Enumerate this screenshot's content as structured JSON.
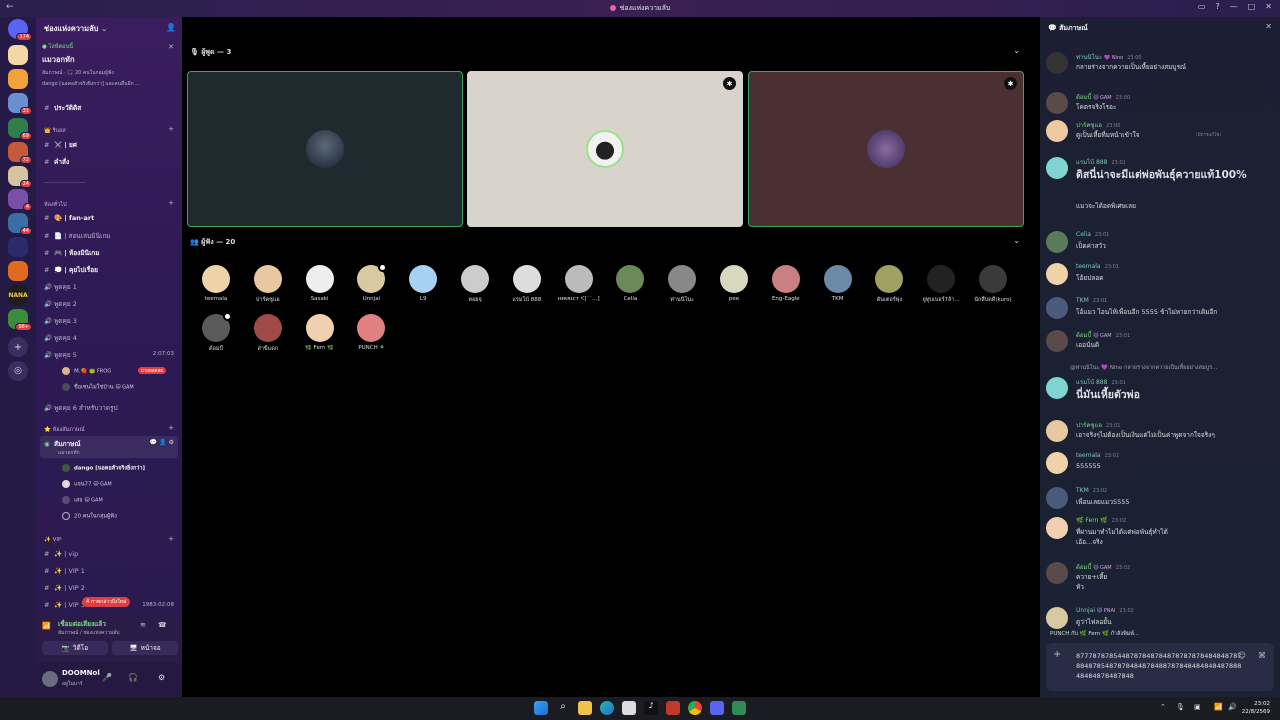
{
  "window": {
    "title": "ช่องแห่งความลับ"
  },
  "server": {
    "name": "ช่องแห่งความลับ",
    "badges": [
      "174",
      "31",
      "69",
      "72",
      "24",
      "4",
      "44",
      "98+"
    ],
    "brand_text": "NANA"
  },
  "event": {
    "live_label": "● ไลฟ์ตอนนี้",
    "title": "แมวอกหัก",
    "line1": "สัมภาษณ์ · 🎧 20 คนในกลุ่มผู้ฟัง",
    "line2": "dango [นอคอสัวจริงยิ่งกว่า] และคนอื่นอีก ..."
  },
  "channels": {
    "top": [
      {
        "label": "ประวัติดิส"
      }
    ],
    "cat_rules": "👑 รีบอส",
    "rules": [
      {
        "label": "⚔️ | ยศ"
      },
      {
        "label": "คำสั่ง"
      }
    ],
    "divider": "-----------------------",
    "cat_general": "ห้องทั่วไป",
    "general": [
      {
        "label": "🎨 | fan-art"
      },
      {
        "label": "📄 | สอนเล่นมินิเกม"
      },
      {
        "label": "🎮 | ห้องมินิเกม"
      },
      {
        "label": "💭 | คุยไปเรื่อย"
      }
    ],
    "voice": [
      "พูดคุย 1",
      "พูดคุย 2",
      "พูดคุย 3",
      "พูดคุย 4",
      "พูดคุย 5"
    ],
    "voice5_timer": "2:07:03",
    "voice5_users": [
      {
        "name": "M.🍓",
        "tag": "🐸 FROG",
        "badge": "ถ่ายทอดสด"
      },
      {
        "name": "ชื่อเซนไม่ใช่บ้าน",
        "tag": "🐱 GAM"
      }
    ],
    "voice6": "พูดคุย 6 สำหรับวาดรูป",
    "cat_stage": "⭐ ห้องสัมภาษณ์",
    "stage_name": "สัมภาษณ์",
    "stage_sub": "แมวอกหัก",
    "stage_users": [
      {
        "name": "dango [นอคอสัวจริงยิ่งกว่า]"
      },
      {
        "name": "แจน77",
        "tag": "🐱 GAM"
      },
      {
        "name": "เสธ",
        "tag": "🐱 GAM"
      },
      {
        "name": "20 คนในกลุ่มผู้ฟัง"
      }
    ],
    "cat_vip": "✨ VIP",
    "vip": [
      "✨ | vip",
      "✨ | VIP 1",
      "✨ | VIP 2",
      "✨ | VIP 3"
    ],
    "vip_timer": "1983:02:08",
    "new_msg_badge": "4 ภาพกล่าวถึงใหม่"
  },
  "voice_panel": {
    "status": "เชื่อมต่อเสียงแล้ว",
    "sub": "สัมภาษณ์ / ช่องแห่งความลับ",
    "btn_video": "วิดีโอ",
    "btn_screen": "หน้าจอ"
  },
  "user_panel": {
    "name": "DOOMNol",
    "status": "อยู่ในบาร์"
  },
  "stage": {
    "speakers_label": "ผู้พูด — 3",
    "audience_label": "ผู้ฟัง — 20",
    "audience": [
      {
        "name": "teemala"
      },
      {
        "name": "ปาร์คซูแอ"
      },
      {
        "name": "Sasaki"
      },
      {
        "name": "Unnjai"
      },
      {
        "name": "L9"
      },
      {
        "name": "หอยจุ"
      },
      {
        "name": "แรมโบ้ 888"
      },
      {
        "name": "нᴇʀʀɪᴄᴛ ᐸ[˙˙...]"
      },
      {
        "name": "Celia"
      },
      {
        "name": "ท่านนิโนะ"
      },
      {
        "name": "pee"
      },
      {
        "name": "Eng-Eagle"
      },
      {
        "name": "TKM"
      },
      {
        "name": "ดันเตอร์พุ่ง"
      },
      {
        "name": "ยูทูบเบอร์7ล้า..."
      },
      {
        "name": "นักสืบดดี(kuro)"
      },
      {
        "name": "ด้อมบี้"
      },
      {
        "name": "สาขิ้แดก"
      },
      {
        "name": "🌿 Fern 🌿"
      },
      {
        "name": "PUNCH ⚘"
      }
    ]
  },
  "chat": {
    "title": "สัมภาษณ์",
    "messages": [
      {
        "name": "ท่านนิโนะ",
        "tag": "💜 Nino",
        "time": "23:00",
        "text": "กลายร่างจากควายเป็นเหี้ยอย่างสมบูรณ์"
      },
      {
        "name": "ด้อมบี้",
        "tag": "🐱 GAM",
        "time": "23:00",
        "text": "โคตรจริงโรอะ"
      },
      {
        "name": "ปาร์คซูแอ",
        "time": "23:00",
        "text": "ดูเป็นเหี้ยที่มหน้าเข้าใจ",
        "edited": "(มีการแก้ไข)"
      },
      {
        "name": "แรมโบ้ 888",
        "time": "23:01",
        "text": "ดิสนี่น่าจะมีแต่พ่อพันธุ์ควายแท้100%",
        "text2": "แมวจะได้อดพิเศษเลย"
      },
      {
        "name": "Celia",
        "time": "23:01",
        "text": "เป็ดค่าสวัว"
      },
      {
        "name": "teemala",
        "time": "23:01",
        "text": "โอ้ยปลอด"
      },
      {
        "name": "TKM",
        "time": "23:01",
        "text": "โอ้แมว ไอนไห้เพื่อนอีก 5555 ข้าไม่หายกว่าเดิมอีก"
      },
      {
        "name": "ด้อมบี้",
        "tag": "🐱 GAM",
        "time": "23:01",
        "text": "เออนั่นดิ"
      },
      {
        "reply": "@ท่านนิโนะ 💜 Nino  กลายร่างจากควายเป็นเหี้ยอย่างสมบูร...",
        "name": "แรมโบ้ 888",
        "time": "23:01",
        "text": "นี่มันเหี้ยตัวพ่อ"
      },
      {
        "name": "ปาร์คซูแอ",
        "time": "23:01",
        "text": "เอาจริงๆไม่ต้องเป็นเงินแต่ไม่เป็นค่าพูดจากใจจริงๆ"
      },
      {
        "name": "teemala",
        "time": "23:02",
        "text": "555555"
      },
      {
        "name": "TKM",
        "time": "23:02",
        "text": "เพื่อนเลยแมว5555"
      },
      {
        "name": "🌿 Fern 🌿",
        "time": "23:02",
        "text": "ที่ผ่านมาทำไมได้แต่พ่อพันธุ์ทำได้",
        "text2": "เอ้อ...จริง"
      },
      {
        "name": "ด้อมบี้",
        "tag": "🐱 GAM",
        "time": "23:02",
        "text": "ควาย+เหี้ย",
        "text2": "หัว"
      },
      {
        "name": "Unnjai",
        "tag": "🐱 PNAI",
        "time": "23:02",
        "text": "ดูว่าไฟลอยั้น"
      }
    ],
    "typing": "PUNCH กับ 🌿 Fern 🌿 กำลังพิมพ์...",
    "input_value": "8777878785448787848784878787878484848787884878548787848487848878784848484848788848484878487848"
  },
  "taskbar": {
    "time": "23:02",
    "date": "22/8/2569"
  }
}
